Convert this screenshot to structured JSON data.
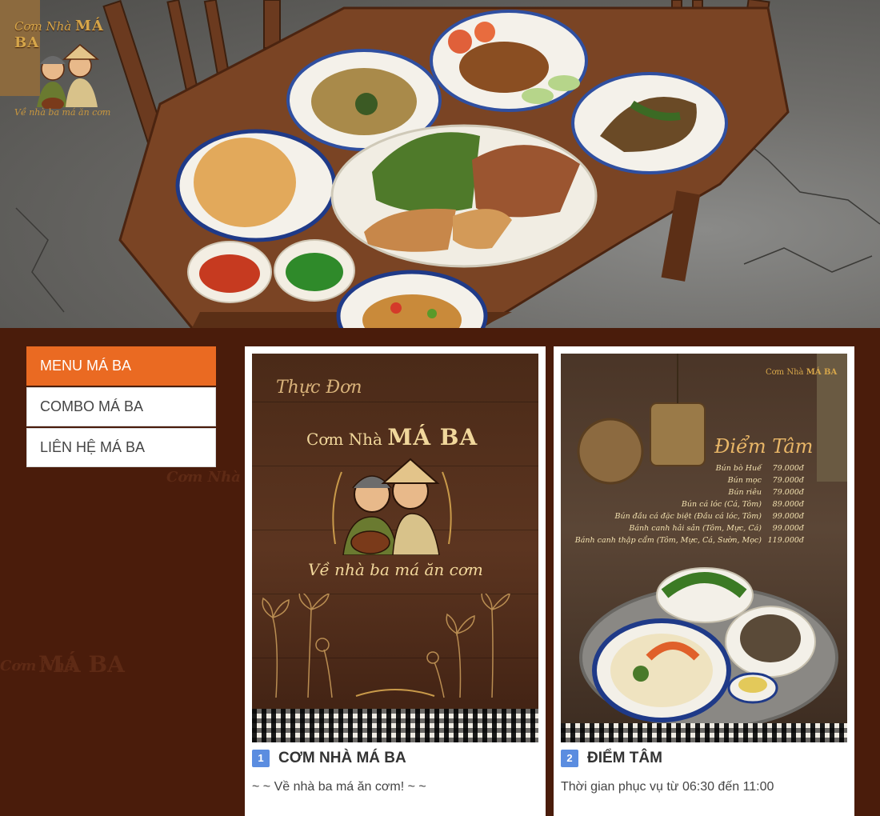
{
  "brand": {
    "name_prefix": "Cơm Nhà",
    "name_main": "MÁ BA",
    "slogan": "Về nhà ba má ăn cơm"
  },
  "side_menu": {
    "items": [
      {
        "label": "MENU MÁ BA",
        "active": true
      },
      {
        "label": "COMBO MÁ BA",
        "active": false
      },
      {
        "label": "LIÊN HỆ MÁ BA",
        "active": false
      }
    ]
  },
  "watermark": {
    "line1": "Cơm Nhà",
    "line2": "MÁ BA"
  },
  "cards": [
    {
      "number": "1",
      "title": "CƠM NHÀ MÁ BA",
      "description": "~ ~ Về nhà ba má ăn cơm! ~ ~",
      "poster": {
        "heading": "Thực Đơn",
        "brand_prefix": "Cơm Nhà",
        "brand_main": "MÁ BA",
        "slogan": "Về nhà ba má ăn cơm"
      }
    },
    {
      "number": "2",
      "title": "ĐIỂM TÂM",
      "description": "Thời gian phục vụ từ 06:30 đến 11:00",
      "poster": {
        "brand_prefix": "Cơm Nhà",
        "brand_main": "MÁ BA",
        "heading": "Điểm Tâm",
        "items": [
          {
            "name": "Bún bò Huế",
            "price": "79.000đ"
          },
          {
            "name": "Bún mọc",
            "price": "79.000đ"
          },
          {
            "name": "Bún riêu",
            "price": "79.000đ"
          },
          {
            "name": "Bún cá lóc (Cá, Tôm)",
            "price": "89.000đ"
          },
          {
            "name": "Bún đầu cá đặc biệt (Đầu cá lóc, Tôm)",
            "price": "99.000đ"
          },
          {
            "name": "Bánh canh hải sản (Tôm, Mực, Cá)",
            "price": "99.000đ"
          },
          {
            "name": "Bánh canh thập cẩm (Tôm, Mực, Cá, Sườn, Mọc)",
            "price": "119.000đ"
          }
        ]
      }
    }
  ],
  "colors": {
    "background": "#4a1c0b",
    "accent": "#ea6a22",
    "badge": "#5b8de0"
  }
}
